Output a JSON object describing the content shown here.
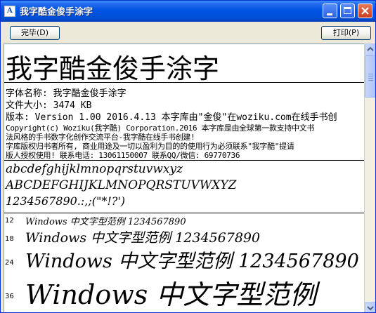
{
  "window": {
    "title": "我字酷金俊手涂字",
    "minimize_label": "",
    "maximize_label": "",
    "close_label": ""
  },
  "toolbar": {
    "done_label": "完毕(D)",
    "print_label": "打印(P)"
  },
  "preview": {
    "heading": "我字酷金俊手涂字",
    "info": {
      "font_name": "字体名称: 我字酷金俊手涂字",
      "file_size": "文件大小: 3474 KB",
      "version": "版本: Version 1.00 2016.4.13 本字库由\"金俊\"在woziku.com在线手书创",
      "line2": "法风格的手书数字化创作交流平台-我字酷在线手书创建!",
      "copyright": "Copyright(c) Woziku(我字酷) Corporation.2016 本字库是由全球第一款支持中文书",
      "rights": "字库版权归书者所有, 商业用途及一切以盈利为目的的使用行为必须联系\"我字酷\"提请",
      "contact": "版人授权使用! 联系电话: 13061150007  联系QQ/微信: 69770736"
    },
    "glyphs": {
      "lower": "abcdefghijklmnopqrstuvwxyz",
      "upper": "ABCDEFGHIJKLMNOPQRSTUVWXYZ",
      "digits": "1234567890.:,;(\"*!?')"
    },
    "samples": [
      {
        "size": "12",
        "text": "Windows 中文字型范例 1234567890"
      },
      {
        "size": "18",
        "text": "Windows 中文字型范例 1234567890"
      },
      {
        "size": "24",
        "text": "Windows 中文字型范例 1234567890"
      },
      {
        "size": "36",
        "text": "Windows 中文字型范例"
      }
    ]
  },
  "scrollbar": {
    "position": 0.0
  }
}
